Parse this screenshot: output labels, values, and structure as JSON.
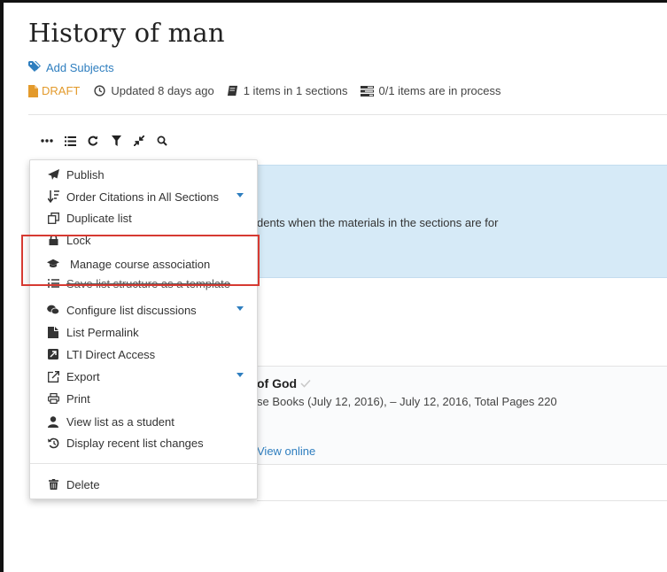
{
  "list": {
    "title": "History of man",
    "add_subjects": "Add Subjects",
    "status": "DRAFT",
    "updated": "Updated 8 days ago",
    "items_sections": "1 items in 1 sections",
    "in_process": "0/1 items are in process"
  },
  "toolbar": {
    "icons": [
      "more-icon",
      "list-icon",
      "refresh-icon",
      "filter-icon",
      "collapse-icon",
      "search-icon"
    ]
  },
  "background": {
    "banner_text": "dents when the materials in the sections are for",
    "card_title": "of God",
    "card_sub": "se Books (July 12, 2016), – July 12, 2016, Total Pages 220",
    "card_link": "View online"
  },
  "menu": {
    "items": [
      {
        "label": "Publish",
        "icon": "paper-plane-icon"
      },
      {
        "label": "Order Citations in All Sections",
        "icon": "sort-icon",
        "has_submenu": true
      },
      {
        "label": "Duplicate list",
        "icon": "duplicate-icon"
      },
      {
        "label": "Lock",
        "icon": "lock-icon"
      },
      {
        "label": "Manage course association",
        "icon": "graduation-cap-icon"
      },
      {
        "label": "Save list structure as a template",
        "icon": "template-icon"
      },
      {
        "label": "Configure list discussions",
        "icon": "discussion-icon",
        "has_submenu": true
      },
      {
        "label": "List Permalink",
        "icon": "permalink-icon"
      },
      {
        "label": "LTI Direct Access",
        "icon": "lti-icon"
      },
      {
        "label": "Export",
        "icon": "export-icon",
        "has_submenu": true
      },
      {
        "label": "Print",
        "icon": "print-icon"
      },
      {
        "label": "View list as a student",
        "icon": "user-icon"
      },
      {
        "label": "Display recent list changes",
        "icon": "history-icon"
      },
      {
        "label": "Delete",
        "icon": "trash-icon"
      }
    ]
  },
  "colors": {
    "link": "#2e7ebf",
    "draft": "#e39a2b",
    "highlight": "#d63a32",
    "banner": "#d6eaf7"
  }
}
